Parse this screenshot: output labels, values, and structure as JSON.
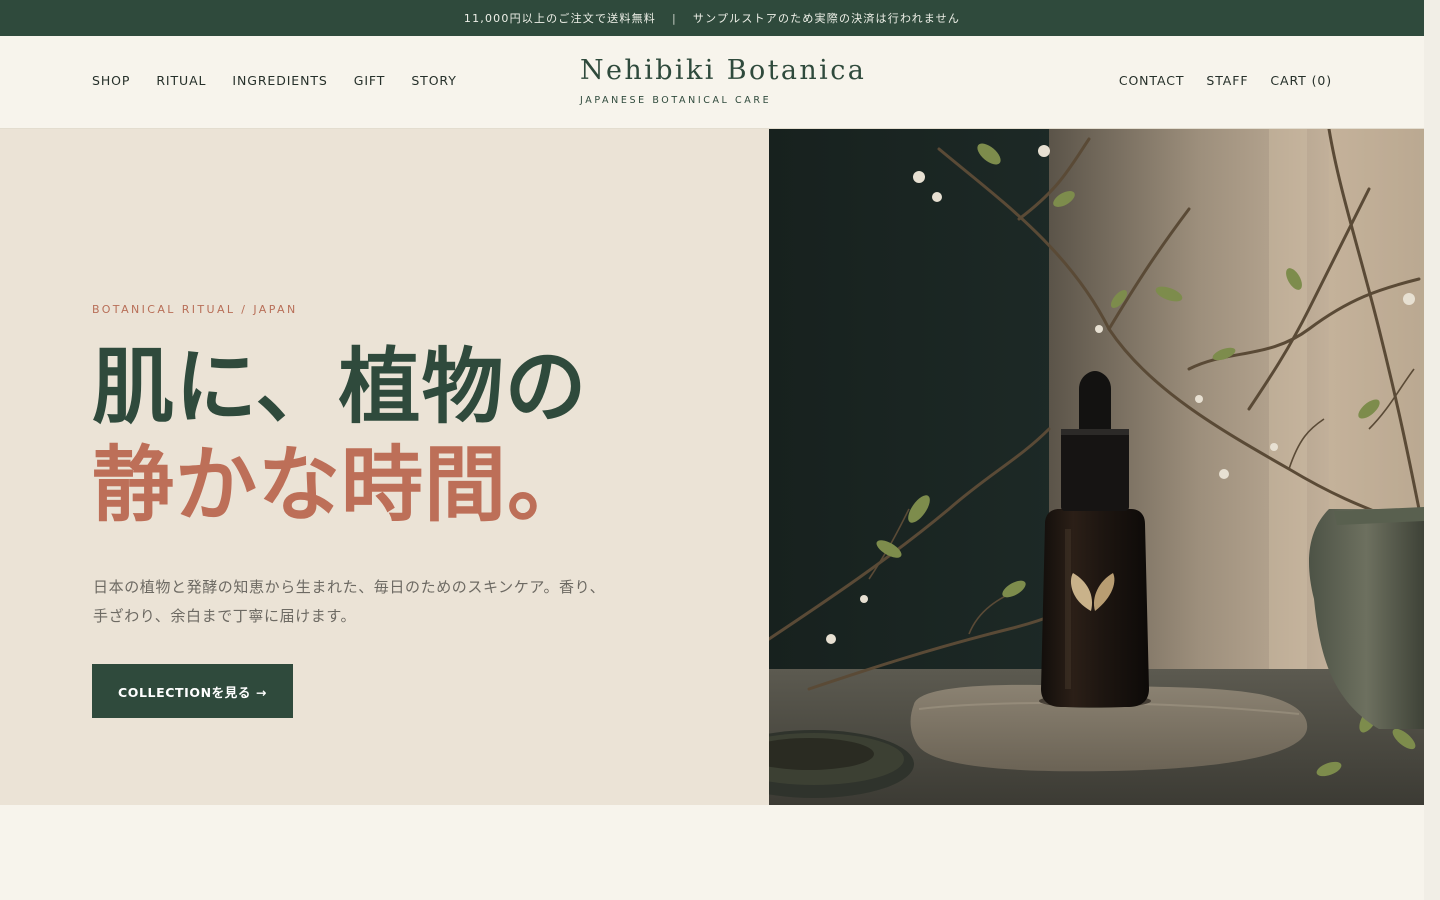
{
  "announcement": {
    "left": "11,000円以上のご注文で送料無料",
    "separator": "|",
    "right": "サンプルストアのため実際の決済は行われません"
  },
  "header": {
    "nav_left": [
      "SHOP",
      "RITUAL",
      "INGREDIENTS",
      "GIFT",
      "STORY"
    ],
    "brand_name": "Nehibiki Botanica",
    "brand_tagline": "JAPANESE BOTANICAL CARE",
    "nav_right": [
      "CONTACT",
      "STAFF",
      "CART (0)"
    ]
  },
  "hero": {
    "eyebrow": "BOTANICAL RITUAL / JAPAN",
    "headline_line1": "肌に、植物の",
    "headline_line2": "静かな時間。",
    "lede_line1": "日本の植物と発酵の知恵から生まれた、毎日のためのスキンケア。香り、",
    "lede_line2": "手ざわり、余白まで丁寧に届けます。",
    "cta_label": "COLLECTIONを見る →",
    "image_icon": "serum-bottle-photo"
  },
  "colors": {
    "brand_green": "#2f4a3c",
    "accent_terracotta": "#bd6f58",
    "hero_bg": "#ebe3d6",
    "page_bg": "#f7f4ec"
  }
}
